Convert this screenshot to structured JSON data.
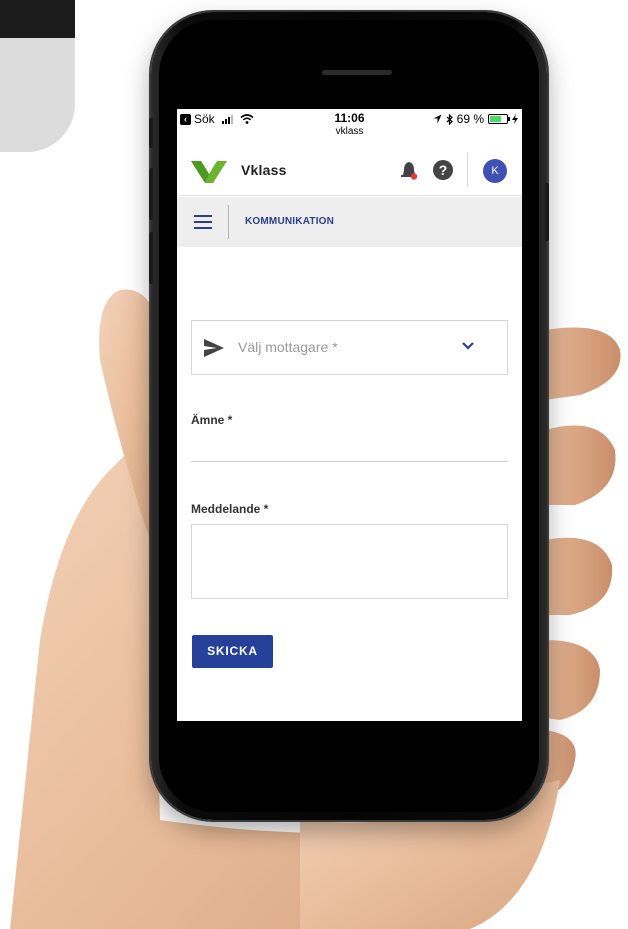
{
  "status_bar": {
    "back_app": "Sök",
    "time": "11:06",
    "subtitle": "vklass",
    "battery": "69 %",
    "battery_level": 0.69
  },
  "app_bar": {
    "brand": "Vklass",
    "help_glyph": "?",
    "avatar_initial": "K",
    "logo_color": "#6cb42c",
    "accent_color": "#3f51b5"
  },
  "nav": {
    "title": "KOMMUNIKATION"
  },
  "form": {
    "recipient_placeholder": "Välj mottagare *",
    "subject_label": "Ämne *",
    "message_label": "Meddelande *",
    "send_label": "SKICKA",
    "button_color": "#26419a"
  },
  "icons": [
    "back-icon",
    "signal-icon",
    "wifi-icon",
    "location-icon",
    "bluetooth-icon",
    "battery-icon",
    "logo-icon",
    "bell-icon",
    "help-icon",
    "menu-icon",
    "send-icon",
    "chevron-down-icon"
  ]
}
